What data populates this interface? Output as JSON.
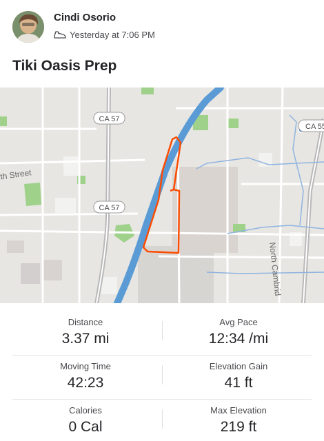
{
  "header": {
    "athlete_name": "Cindi Osorio",
    "timestamp": "Yesterday at 7:06 PM",
    "activity_icon": "shoe-icon"
  },
  "activity": {
    "title": "Tiki Oasis Prep"
  },
  "map": {
    "road_labels": {
      "ca57_top": "CA 57",
      "ca57_mid": "CA 57",
      "ca57_right": "CA 55",
      "north_street": "rth Street",
      "north_cambridge": "North Cambrid"
    },
    "colors": {
      "route": "#fc4c02",
      "river": "#5b9bd5",
      "land": "#e7e6e2",
      "park": "#9fd18b"
    }
  },
  "stats": [
    {
      "left_label": "Distance",
      "left_value": "3.37 mi",
      "right_label": "Avg Pace",
      "right_value": "12:34 /mi"
    },
    {
      "left_label": "Moving Time",
      "left_value": "42:23",
      "right_label": "Elevation Gain",
      "right_value": "41 ft"
    },
    {
      "left_label": "Calories",
      "left_value": "0 Cal",
      "right_label": "Max Elevation",
      "right_value": "219 ft"
    }
  ]
}
